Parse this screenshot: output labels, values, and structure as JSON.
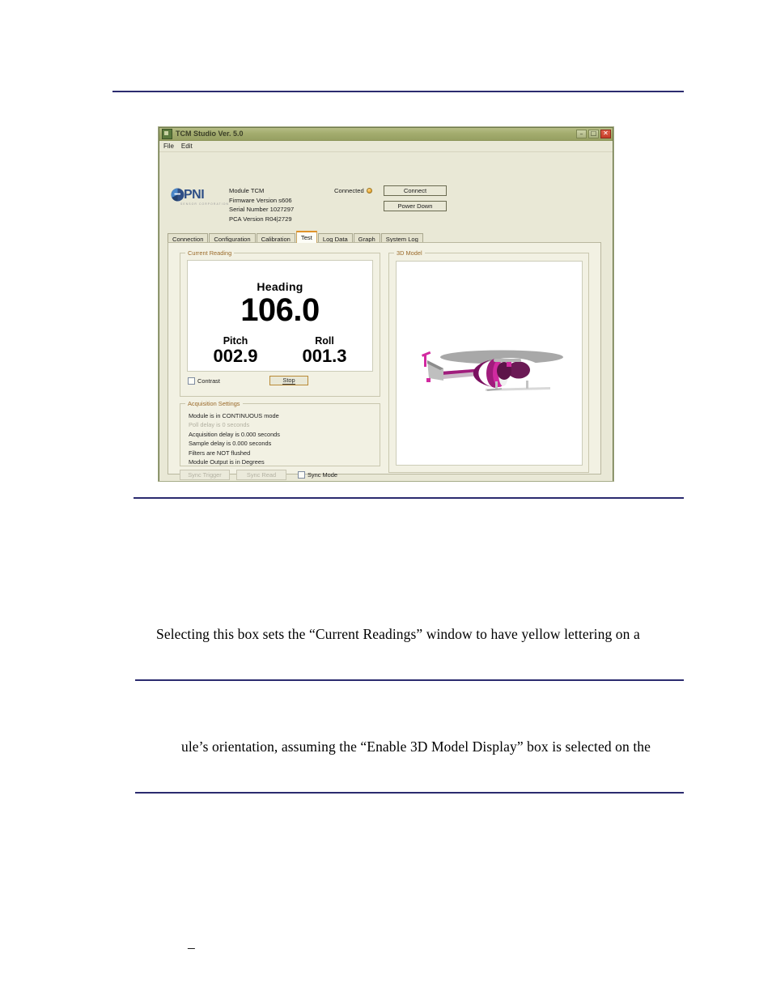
{
  "document": {
    "paragraph_1": "Selecting this box sets the “Current Readings” window to have yellow lettering on a",
    "paragraph_2": "ule’s orientation, assuming the “Enable 3D Model Display” box is selected on the",
    "footer_dash": "–",
    "rule_color": "#2b2b6f"
  },
  "app": {
    "title": "TCM Studio Ver. 5.0",
    "title_icon": "app-icon",
    "window_buttons": {
      "minimize": "–",
      "maximize": "□",
      "close": "✕"
    },
    "menu": [
      {
        "label": "File"
      },
      {
        "label": "Edit"
      }
    ],
    "branding": {
      "logo_text": "PNI",
      "logo_sub": "SENSOR CORPORATION",
      "logo_color": "#2f4f86"
    },
    "module_info": [
      "Module TCM",
      "Firmware Version s606",
      "Serial Number 1027297",
      "PCA Version R04|2729"
    ],
    "connection": {
      "status_label": "Connected",
      "led_name": "status-led",
      "led_color": "#e8a32b",
      "connect_label": "Connect",
      "power_down_label": "Power Down"
    },
    "tabs": [
      {
        "label": "Connection",
        "active": false
      },
      {
        "label": "Configuration",
        "active": false
      },
      {
        "label": "Calibration",
        "active": false
      },
      {
        "label": "Test",
        "active": true
      },
      {
        "label": "Log Data",
        "active": false
      },
      {
        "label": "Graph",
        "active": false
      },
      {
        "label": "System Log",
        "active": false
      }
    ],
    "current_reading": {
      "group_title": "Current Reading",
      "heading_label": "Heading",
      "heading_value": "106.0",
      "pitch_label": "Pitch",
      "pitch_value": "002.9",
      "roll_label": "Roll",
      "roll_value": "001.3",
      "contrast_label": "Contrast",
      "contrast_checked": false,
      "stop_label": "Stop"
    },
    "acquisition_settings": {
      "group_title": "Acquisition Settings",
      "lines": [
        {
          "text": "Module is in CONTINUOUS mode",
          "dimmed": false
        },
        {
          "text": "Poll delay is 0 seconds",
          "dimmed": true
        },
        {
          "text": "Acquisition delay is 0.000 seconds",
          "dimmed": false
        },
        {
          "text": "Sample delay is 0.000 seconds",
          "dimmed": false
        },
        {
          "text": "Filters are NOT flushed",
          "dimmed": false
        },
        {
          "text": "Module Output is in Degrees",
          "dimmed": false
        }
      ],
      "sync_trigger_label": "Sync Trigger",
      "sync_read_label": "Sync Read",
      "sync_mode_label": "Sync Mode",
      "sync_mode_checked": false
    },
    "model_3d": {
      "group_title": "3D Model",
      "model_name": "helicopter-model",
      "body_color": "#b01a84",
      "rotor_color": "#a8a8a8",
      "highlight_color": "#ffffff"
    }
  }
}
